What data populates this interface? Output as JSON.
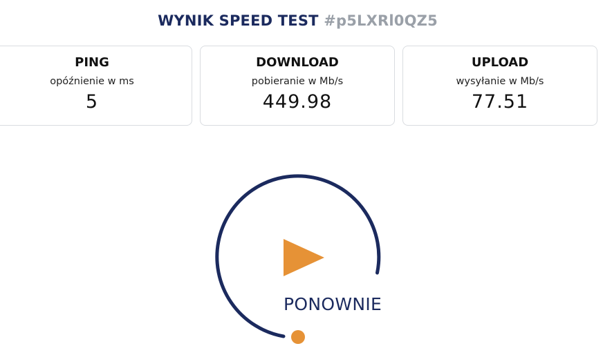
{
  "header": {
    "title": "WYNIK SPEED TEST",
    "test_id": "#p5LXRl0QZ5"
  },
  "results": {
    "ping": {
      "name": "PING",
      "desc": "opóźnienie w ms",
      "value": "5"
    },
    "download": {
      "name": "DOWNLOAD",
      "desc": "pobieranie w Mb/s",
      "value": "449.98"
    },
    "upload": {
      "name": "UPLOAD",
      "desc": "wysyłanie w Mb/s",
      "value": "77.51"
    }
  },
  "restart": {
    "label": "PONOWNIE",
    "icon": "play-icon"
  },
  "colors": {
    "navy": "#1b2a5e",
    "orange": "#e69236",
    "muted": "#9aa0a8"
  }
}
